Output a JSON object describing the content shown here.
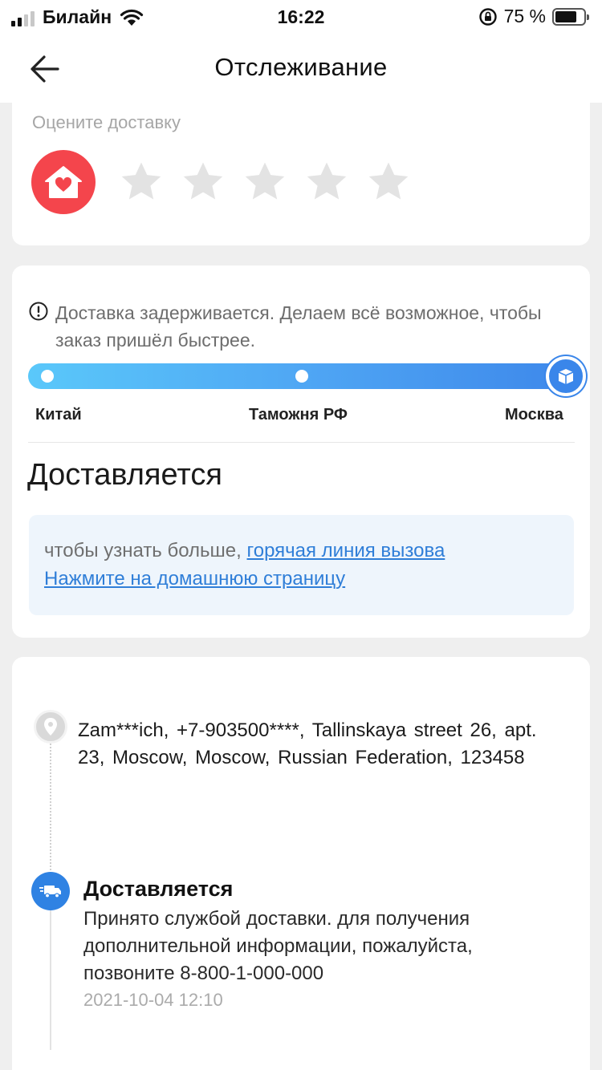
{
  "status_bar": {
    "carrier": "Билайн",
    "time": "16:22",
    "battery_percent": "75 %",
    "battery_level": 0.75
  },
  "nav": {
    "title": "Отслеживание",
    "back_icon": "arrow-left-icon"
  },
  "rating": {
    "label": "Оцените доставку",
    "icon": "home-heart-icon",
    "stars_total": 5,
    "stars_selected": 0,
    "star_color": "#e3e3e3",
    "avatar_color": "#f4454c"
  },
  "status": {
    "delay_icon": "info-icon",
    "delay_message": "Доставка задерживается. Делаем всё возможное, чтобы заказ пришёл быстрее.",
    "stages": [
      "Китай",
      "Таможня РФ",
      "Москва"
    ],
    "current_stage_index": 2,
    "current_stage_icon": "package-icon",
    "heading": "Доставляется",
    "help_text": "чтобы узнать больше,",
    "hotline_link": "горячая линия вызова",
    "home_link": "Нажмите на домашнюю страницу",
    "accent_color": "#3a86ea"
  },
  "tracking": {
    "pin_icon": "location-pin-icon",
    "address": "Zam***ich,  +7-903500****,  Tallinskaya street 26,  apt. 23,  Moscow,  Moscow,  Russian Federation,  123458",
    "event_icon": "truck-icon",
    "event_title": "Доставляется",
    "event_description": "Принято службой доставки. для получения дополнительной информации, пожалуйста, позвоните 8-800-1-000-000",
    "event_time": "2021-10-04 12:10"
  }
}
